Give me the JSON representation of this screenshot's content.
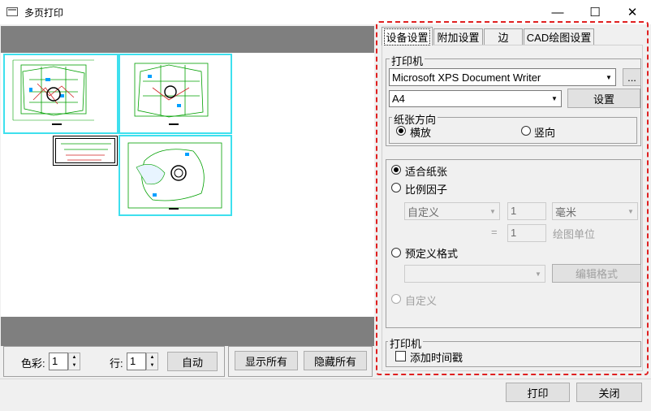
{
  "window": {
    "title": "多页打印",
    "minimize_glyph": "—",
    "maximize_glyph": "☐",
    "close_glyph": "✕"
  },
  "preview": {
    "sheets": [
      {
        "name": "floor-plan-1"
      },
      {
        "name": "floor-plan-2"
      },
      {
        "name": "floor-plan-3"
      }
    ]
  },
  "bottom_toolbar": {
    "color_label": "色彩:",
    "color_value": "1",
    "row_label": "行:",
    "row_value": "1",
    "auto_button": "自动",
    "show_all_button": "显示所有",
    "hide_all_button": "隐藏所有"
  },
  "tabs": [
    {
      "label": "设备设置",
      "active": true
    },
    {
      "label": "附加设置",
      "active": false
    },
    {
      "label": "边",
      "active": false
    },
    {
      "label": "CAD绘图设置",
      "active": false
    }
  ],
  "printer_group": {
    "legend": "打印机",
    "printer_value": "Microsoft XPS Document Writer",
    "browse_button": "...",
    "paper_value": "A4",
    "setup_button": "设置"
  },
  "orientation_group": {
    "legend": "纸张方向",
    "landscape_label": "横放",
    "portrait_label": "竖向",
    "selected": "landscape"
  },
  "scaling": {
    "fit_paper_label": "适合纸张",
    "scale_factor_label": "比例因子",
    "custom_value": "自定义",
    "factor_value": "1",
    "unit_value": "毫米",
    "equals_label": "=",
    "drawing_value": "1",
    "drawing_unit_label": "绘图单位",
    "predefined_label": "预定义格式",
    "predefined_value": "",
    "edit_format_button": "编辑格式",
    "custom_label": "自定义",
    "selected": "fit_paper"
  },
  "timestamp_group": {
    "legend": "打印机",
    "add_timestamp_label": "添加时间戳",
    "checked": false
  },
  "footer": {
    "print_button": "打印",
    "close_button": "关闭"
  },
  "colors": {
    "sheet_border": "#3ee0ee",
    "highlight_border": "#e02020",
    "preview_bg": "#7f7f7f"
  }
}
